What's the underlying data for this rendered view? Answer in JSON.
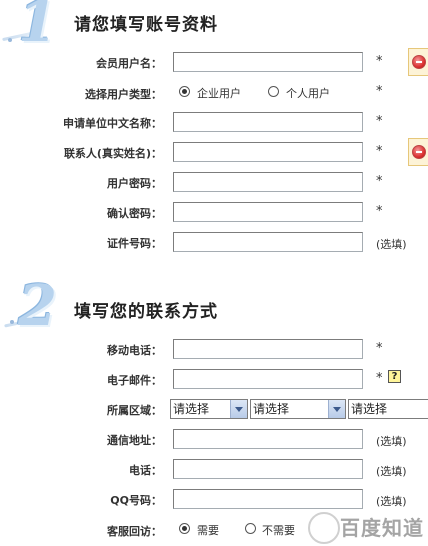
{
  "section1": {
    "number": "1",
    "title": "请您填写账号资料"
  },
  "section2": {
    "number": "2",
    "title": "填写您的联系方式"
  },
  "account": {
    "member_name_label": "会员用户名：",
    "user_type_label": "选择用户类型：",
    "user_type_options": [
      "企业用户",
      "个人用户"
    ],
    "company_name_label": "申请单位中文名称：",
    "contact_label": "联系人(真实姓名)：",
    "password_label": "用户密码：",
    "confirm_password_label": "确认密码：",
    "id_number_label": "证件号码："
  },
  "contact": {
    "mobile_label": "移动电话：",
    "email_label": "电子邮件：",
    "region_label": "所属区域：",
    "region_selects": [
      "请选择",
      "请选择",
      "请选择"
    ],
    "address_label": "通信地址：",
    "phone_label": "电话：",
    "qq_label": "QQ号码：",
    "followup_label": "客服回访：",
    "followup_options": [
      "需要",
      "不需要"
    ]
  },
  "marks": {
    "required": "*",
    "optional": "(选填)",
    "help": "?"
  },
  "watermark": {
    "text": "百度知道"
  },
  "icons": {
    "error": "error-icon",
    "help": "question-icon"
  }
}
